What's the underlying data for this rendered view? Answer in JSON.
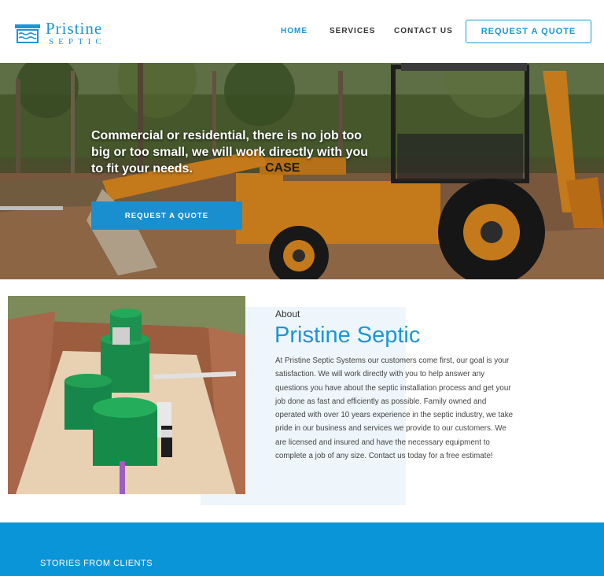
{
  "brand": {
    "name_line1": "Pristine",
    "name_line2": "Septic",
    "color": "#1a96d4"
  },
  "nav": {
    "items": [
      {
        "label": "HOME",
        "active": true
      },
      {
        "label": "SERVICES",
        "active": false
      },
      {
        "label": "CONTACT US",
        "active": false
      }
    ],
    "cta_label": "REQUEST A QUOTE"
  },
  "hero": {
    "headline": "Commercial or residential, there is no job too big or too small, we will work directly with you to fit your needs.",
    "button_label": "REQUEST A QUOTE",
    "image": "backhoe-loader-photo"
  },
  "about": {
    "kicker": "About",
    "title": "Pristine Septic",
    "body": "At Pristine Septic Systems our customers come first, our goal is your satisfaction. We will work directly with you to help answer any questions you have about the septic installation process and get your job done as fast and efficiently as possible. Family owned and operated with over 10 years experience in the septic industry, we take pride in our business and services we provide to our customers. We are licensed and insured and have the necessary equipment to complete a job of any size. Contact us today for a free estimate!",
    "image": "septic-tank-install-photo"
  },
  "testimonials": {
    "heading": "STORIES FROM CLIENTS",
    "band_color": "#0a95d8"
  }
}
